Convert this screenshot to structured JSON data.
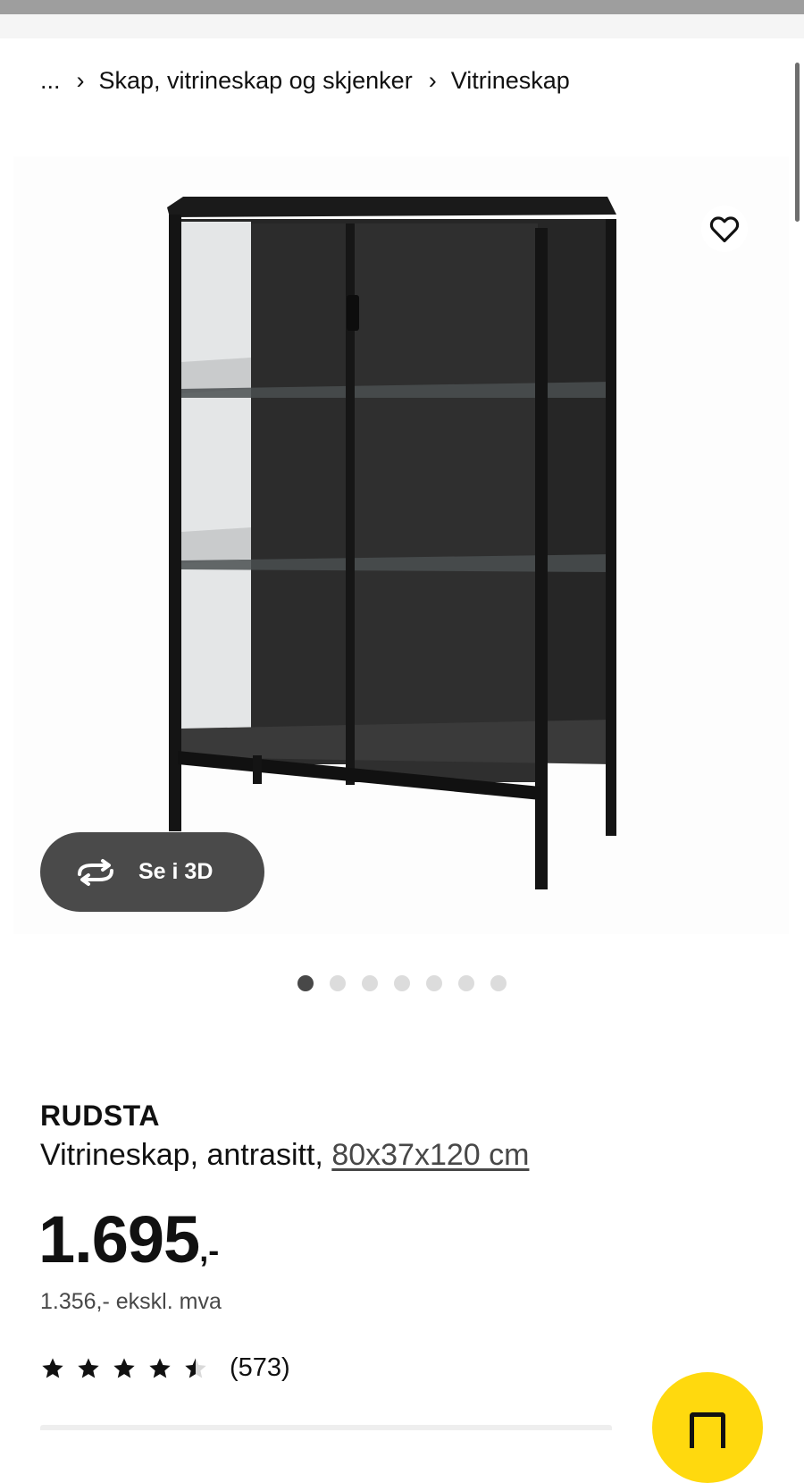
{
  "breadcrumb": {
    "ellipsis": "...",
    "items": [
      {
        "label": "Skap, vitrineskap og skjenker"
      },
      {
        "label": "Vitrineskap"
      }
    ]
  },
  "gallery": {
    "view_3d_label": "Se i 3D",
    "image_count": 7,
    "active_index": 0
  },
  "product": {
    "name": "RUDSTA",
    "description": "Vitrineskap, antrasitt,",
    "dimensions": "80x37x120 cm",
    "price": {
      "integer": "1.695",
      "suffix": ",-",
      "excl_vat": "1.356,- ekskl. mva"
    },
    "rating": {
      "value": 4.5,
      "max": 5,
      "count": "(573)"
    }
  },
  "colors": {
    "accent": "#ffd90e",
    "button_dark": "#4a4a4a",
    "text": "#111111"
  },
  "icons": {
    "favorite": "heart-icon",
    "view3d": "rotate-3d-icon",
    "cart": "shopping-bag-icon",
    "breadcrumb_separator": "chevron-right-icon"
  }
}
